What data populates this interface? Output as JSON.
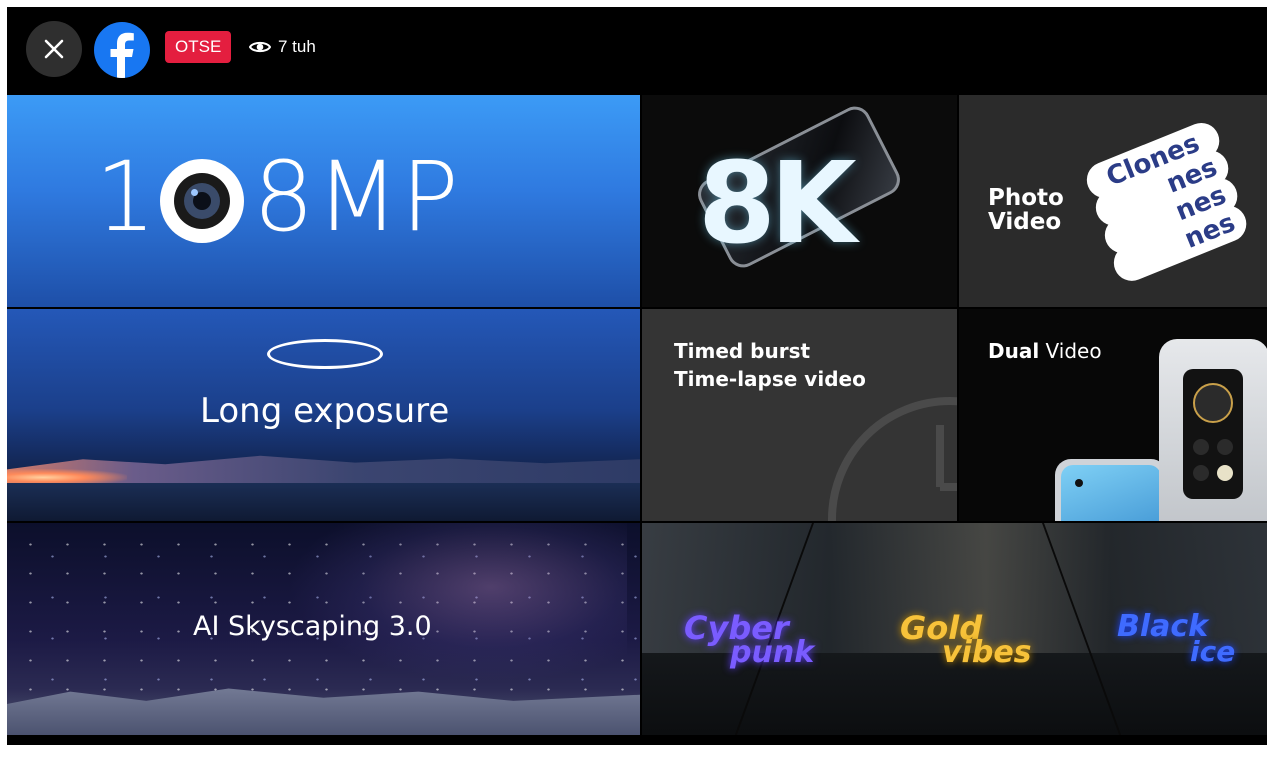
{
  "topbar": {
    "close_icon": "close-icon",
    "app_icon": "facebook-logo",
    "live_badge": "OTSE",
    "viewer_icon": "eye-icon",
    "viewer_count": "7 tuh",
    "colors": {
      "facebook_blue": "#1877f2",
      "live_red": "#e41e3f"
    }
  },
  "tiles": {
    "mp": {
      "digit_one": "1",
      "rest": "8MP"
    },
    "eightk": {
      "text": "8K"
    },
    "clones": {
      "left_line1": "Photo",
      "left_line2": "Video",
      "word": "Clones",
      "echo": "nes"
    },
    "long_exposure": {
      "label": "Long exposure"
    },
    "timed": {
      "line1": "Timed burst",
      "line2": "Time-lapse video"
    },
    "dual": {
      "label_bold": "Dual",
      "label_rest": " Video"
    },
    "sky": {
      "label": "AI Skyscaping 3.0"
    },
    "filters": {
      "cyber": "Cyber",
      "punk": "punk",
      "gold": "Gold",
      "vibes": "vibes",
      "black": "Black",
      "ice": "ice"
    }
  }
}
